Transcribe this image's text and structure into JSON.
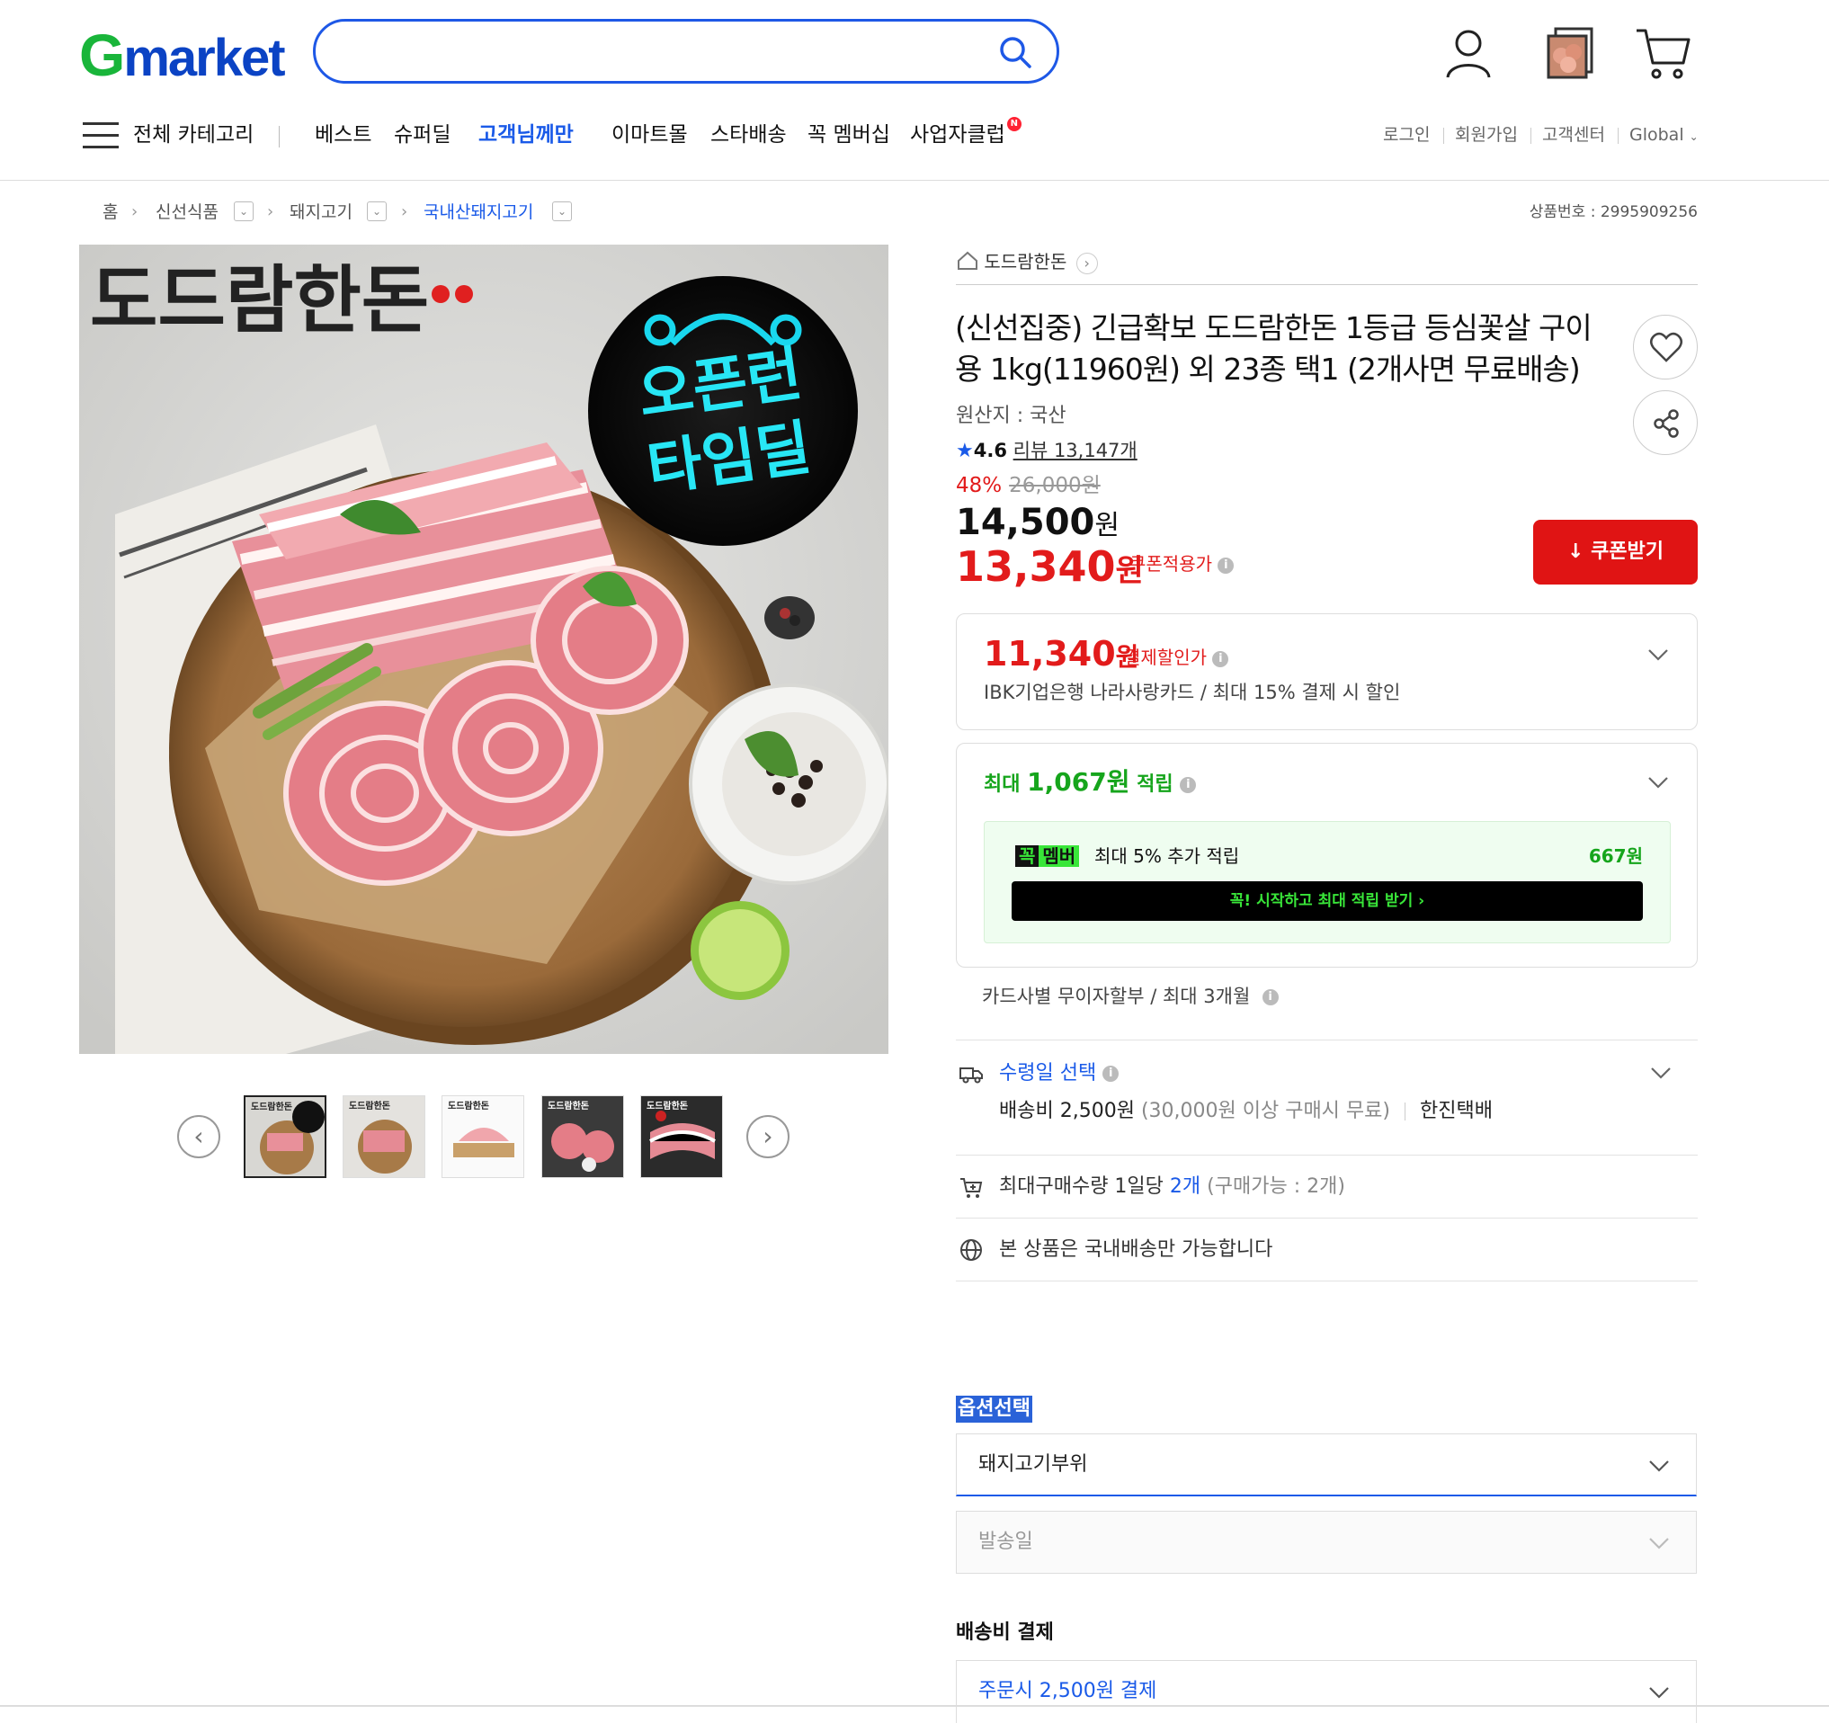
{
  "header": {
    "logo_g": "G",
    "logo_rest": "market",
    "search_placeholder": "",
    "nav": {
      "all_categories": "전체 카테고리",
      "items": [
        "베스트",
        "슈퍼딜",
        "고객님께만",
        "이마트몰",
        "스타배송",
        "꼭 멤버십",
        "사업자클럽"
      ],
      "new_badge": "N"
    },
    "util": [
      "로그인",
      "회원가입",
      "고객센터",
      "Global"
    ]
  },
  "breadcrumb": {
    "items": [
      "홈",
      "신선식품",
      "돼지고기",
      "국내산돼지고기"
    ],
    "product_no": "상품번호 : 2995909256"
  },
  "image": {
    "brand_text": "도드람한돈",
    "badge_line1": "오픈런",
    "badge_line2": "타임딜",
    "thumb_count": 5
  },
  "product": {
    "seller": "도드람한돈",
    "title": "(신선집중) 긴급확보 도드람한돈 1등급 등심꽃살 구이용 1kg(11960원) 외 23종 택1 (2개사면 무료배송)",
    "origin": "원산지 : 국산",
    "rating": "4.6",
    "review": "리뷰 13,147개",
    "discount_rate": "48%",
    "original_price": "26,000원",
    "price_num": "14,500",
    "price_unit": "원",
    "coupon_price_num": "13,340",
    "coupon_price_unit": "원",
    "coupon_label": "쿠폰적용가",
    "coupon_button": "쿠폰받기"
  },
  "payment": {
    "price_num": "11,340",
    "price_unit": "원",
    "label": "결제할인가",
    "desc": "IBK기업은행 나라사랑카드 / 최대 15% 결제 시 할인"
  },
  "points": {
    "prefix": "최대",
    "amount": "1,067원",
    "suffix": "적립",
    "member_tag_k": "꼭",
    "member_tag_m": "멤버",
    "member_desc": "최대 5% 추가 적립",
    "member_amount": "667원",
    "member_button": "꼭! 시작하고 최대 적립 받기 ›"
  },
  "installment": "카드사별 무이자할부 / 최대 3개월",
  "delivery": {
    "title": "수령일 선택",
    "fee": "배송비 2,500원",
    "fee_note": "(30,000원 이상 구매시 무료)",
    "carrier": "한진택배"
  },
  "max_buy": {
    "text": "최대구매수량 1일당",
    "qty": "2개",
    "note": "(구매가능 : 2개)"
  },
  "domestic": "본 상품은 국내배송만 가능합니다",
  "options": {
    "title": "옵션선택",
    "select1": "돼지고기부위",
    "select2": "발송일"
  },
  "shipping_payment": {
    "title": "배송비 결제",
    "select": "주문시 2,500원 결제"
  },
  "colors": {
    "brand_green": "#19b53a",
    "brand_blue": "#0b43c4",
    "accent_blue": "#1a5ae8",
    "sale_red": "#e21b1b",
    "point_green": "#16a51c"
  }
}
